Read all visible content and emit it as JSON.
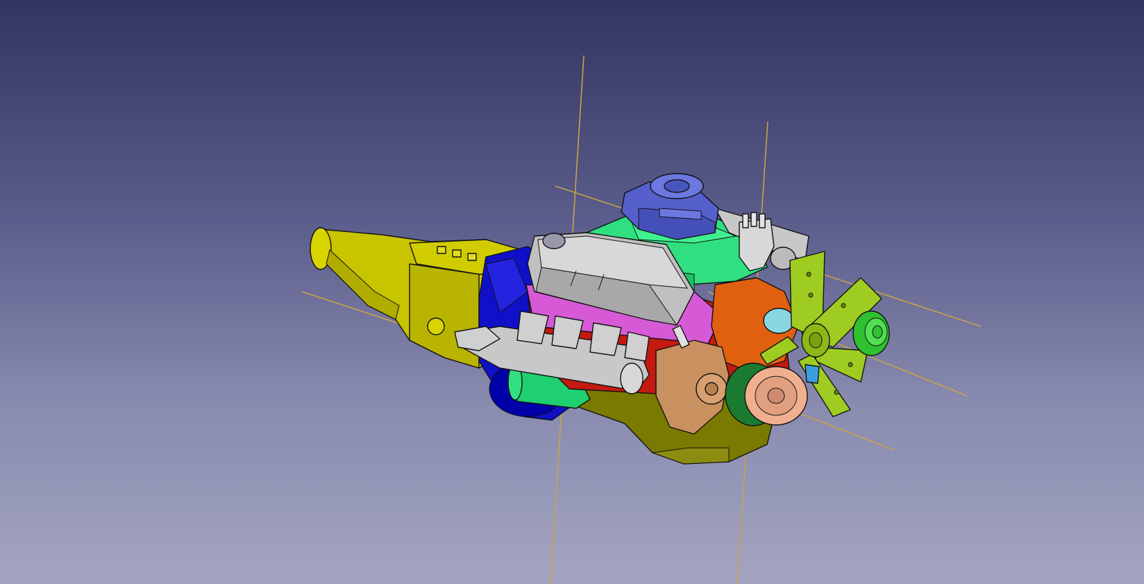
{
  "viewport": {
    "kind": "3d-cad-viewport",
    "background_top": "#33345f",
    "background_bottom": "#a3a5c0"
  },
  "model": {
    "subject": "v8-engine-with-transmission-assembly",
    "colors": {
      "transmission": "#c8c400",
      "bellhousing": "#1010c8",
      "oil_pan": "#7a7a00",
      "valve_cover": "#bdbdbd",
      "cylinder_head": "#d65ad6",
      "intake_manifold": "#30e080",
      "carburetor": "#5560cc",
      "block_front": "#c41a10",
      "timing_cover": "#e06010",
      "fan": "#9fcc20",
      "pulley": "#f0b090",
      "distributor": "#d8d8d8",
      "starter": "#20d070",
      "alternator": "#c99060",
      "exhaust": "#c8c8c8",
      "axis_line": "#c9a24a"
    }
  }
}
